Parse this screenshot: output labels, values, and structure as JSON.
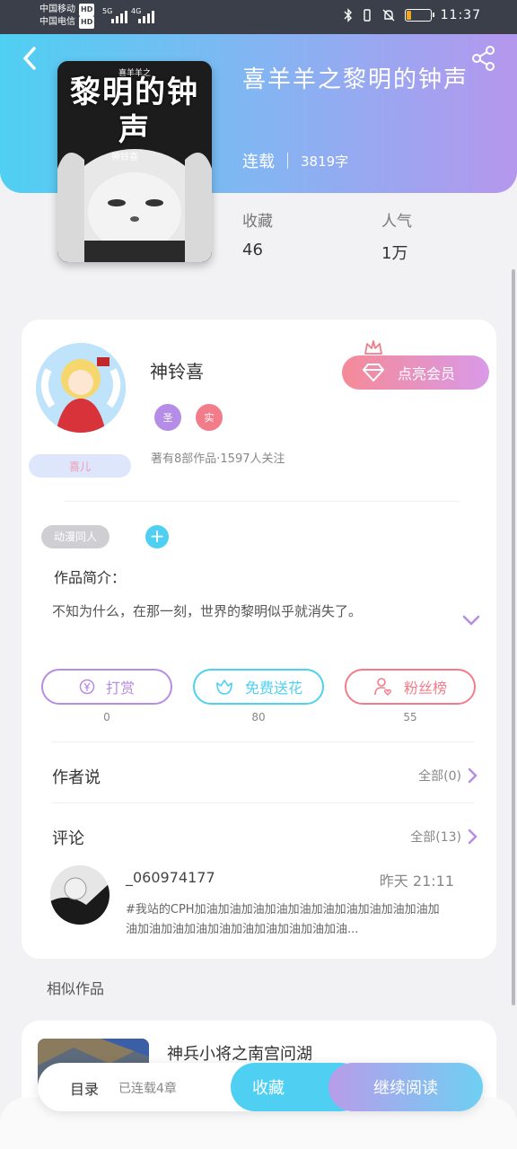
{
  "status_bar": {
    "carrier1": "中国移动",
    "carrier2": "中国电信",
    "hd": "HD",
    "net1": "5G",
    "net2": "4G",
    "time": "11:37",
    "battery_level": 0.2,
    "battery_color": "#f5a623"
  },
  "book": {
    "cover_title": "黎明的钟声",
    "cover_series": "喜羊羊之",
    "cover_author": "神铃喜",
    "title": "喜羊羊之黎明的钟声",
    "status": "连载",
    "word_count": "3819字",
    "collect_label": "收藏",
    "collect_value": "46",
    "popularity_label": "人气",
    "popularity_value": "1万"
  },
  "author": {
    "name": "神铃喜",
    "badges": [
      "圣",
      "实"
    ],
    "badge_colors": [
      "#b58de6",
      "#f27c8a"
    ],
    "stats": "著有8部作品·1597人关注",
    "sticker": "喜儿",
    "vip_button": "点亮会员"
  },
  "tags": {
    "items": [
      "动漫同人"
    ],
    "add_label": "+"
  },
  "intro": {
    "label": "作品简介：",
    "text": "不知为什么，在那一刻，世界的黎明似乎就消失了。"
  },
  "actions": [
    {
      "label": "打赏",
      "count": "0",
      "color": "#b58de6"
    },
    {
      "label": "免费送花",
      "count": "80",
      "color": "#4fd0f2"
    },
    {
      "label": "粉丝榜",
      "count": "55",
      "color": "#f27c8a"
    }
  ],
  "author_says": {
    "title": "作者说",
    "more": "全部(0)"
  },
  "comments": {
    "title": "评论",
    "more": "全部(13)",
    "items": [
      {
        "user": "_060974177",
        "time": "昨天 21:11",
        "text": "#我站的CPH加油加油加油加油加油加油加油加油加油加油加油加油加油加油加油加油加油加油加油加油..."
      }
    ]
  },
  "similar": {
    "label": "相似作品",
    "items": [
      {
        "title": "神兵小将之南宫问湖"
      }
    ]
  },
  "bottom_bar": {
    "catalog": "目录",
    "progress": "已连载4章",
    "collect": "收藏",
    "read": "继续阅读"
  },
  "icons": {
    "back": "chevron-left-icon",
    "share": "share-icon",
    "vip": "diamond-icon",
    "crown": "crown-icon",
    "reward": "yen-coin-icon",
    "flower": "flower-icon",
    "fans": "user-heart-icon",
    "more": "chevron-right-icon",
    "expand": "chevron-down-icon"
  }
}
